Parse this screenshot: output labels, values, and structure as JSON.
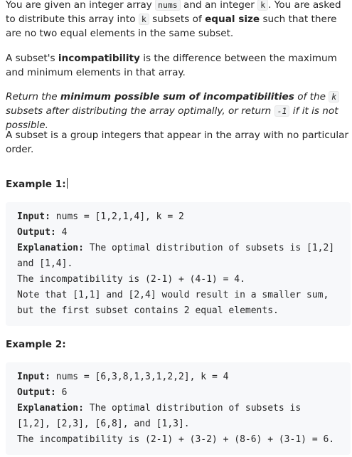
{
  "problem": {
    "p1_a": "You are given an integer array ",
    "p1_code1": "nums",
    "p1_b": " and an integer ",
    "p1_code2": "k",
    "p1_c": ". You are asked to distribute this array into ",
    "p1_code3": "k",
    "p1_d": " subsets of ",
    "p1_bold": "equal size",
    "p1_e": " such that there are no two equal elements in the same subset.",
    "p2_a": "A subset's ",
    "p2_bold": "incompatibility",
    "p2_b": " is the difference between the maximum and minimum elements in that array.",
    "p3_a": "Return the ",
    "p3_bold": "minimum possible sum of incompatibilities",
    "p3_b": " of the ",
    "p3_code1": "k",
    "p3_c": " subsets after distributing the array optimally, or return ",
    "p3_code2": "-1",
    "p3_d": " if it is not possible.",
    "p4": "A subset is a group integers that appear in the array with no particular order."
  },
  "examples": [
    {
      "title": "Example 1:",
      "input_label": "Input:",
      "input": " nums = [1,2,1,4], k = 2",
      "output_label": "Output:",
      "output": " 4",
      "explanation_label": "Explanation:",
      "explanation": " The optimal distribution of subsets is [1,2]\nand [1,4].\nThe incompatibility is (2-1) + (4-1) = 4.\nNote that [1,1] and [2,4] would result in a smaller sum,\nbut the first subset contains 2 equal elements."
    },
    {
      "title": "Example 2:",
      "input_label": "Input:",
      "input": " nums = [6,3,8,1,3,1,2,2], k = 4",
      "output_label": "Output:",
      "output": " 6",
      "explanation_label": "Explanation:",
      "explanation": " The optimal distribution of subsets is\n[1,2], [2,3], [6,8], and [1,3].\nThe incompatibility is (2-1) + (3-2) + (8-6) + (3-1) = 6."
    }
  ]
}
